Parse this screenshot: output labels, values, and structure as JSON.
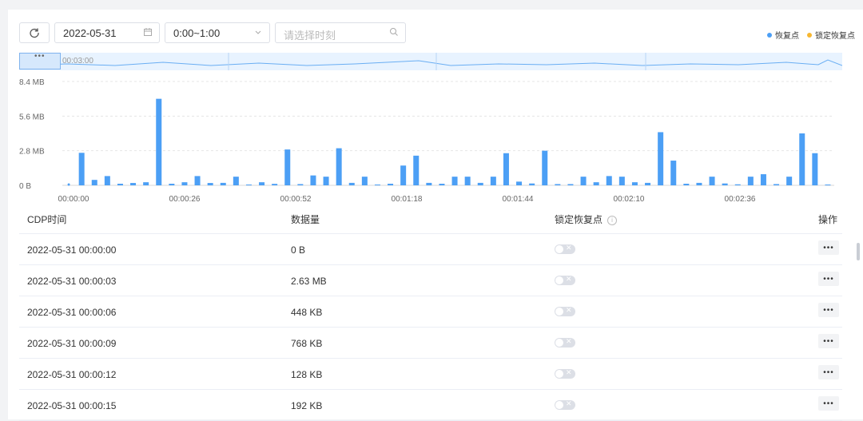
{
  "toolbar": {
    "date_value": "2022-05-31",
    "time_range_value": "0:00~1:00",
    "moment_placeholder": "请选择时刻"
  },
  "legend": [
    {
      "label": "恢复点",
      "color": "#4c9ff5"
    },
    {
      "label": "锁定恢复点",
      "color": "#f7b731"
    }
  ],
  "overview": {
    "label": "00:03:00"
  },
  "chart_data": {
    "type": "bar",
    "y_ticks": [
      "0 B",
      "2.8 MB",
      "5.6 MB",
      "8.4 MB"
    ],
    "ylim": [
      0,
      8.4
    ],
    "x_ticks": [
      "00:00:00",
      "00:00:26",
      "00:00:52",
      "00:01:18",
      "00:01:44",
      "00:02:10",
      "00:02:36"
    ],
    "bar_color": "#4c9ff5",
    "values": [
      0.0,
      2.63,
      0.44,
      0.75,
      0.13,
      0.19,
      0.25,
      7.0,
      0.13,
      0.25,
      0.75,
      0.19,
      0.2,
      0.7,
      0.06,
      0.25,
      0.12,
      2.9,
      0.1,
      0.8,
      0.7,
      3.0,
      0.2,
      0.7,
      0.06,
      0.13,
      1.6,
      2.4,
      0.2,
      0.13,
      0.7,
      0.7,
      0.2,
      0.7,
      2.6,
      0.3,
      0.15,
      2.8,
      0.1,
      0.1,
      0.7,
      0.25,
      0.75,
      0.7,
      0.25,
      0.2,
      4.3,
      2.0,
      0.13,
      0.2,
      0.7,
      0.15,
      0.08,
      0.7,
      0.9,
      0.1,
      0.7,
      4.2,
      2.6,
      0.05
    ]
  },
  "table": {
    "headers": [
      "CDP时间",
      "数据量",
      "锁定恢复点",
      "操作"
    ],
    "rows": [
      {
        "time": "2022-05-31 00:00:00",
        "size": "0 B"
      },
      {
        "time": "2022-05-31 00:00:03",
        "size": "2.63 MB"
      },
      {
        "time": "2022-05-31 00:00:06",
        "size": "448 KB"
      },
      {
        "time": "2022-05-31 00:00:09",
        "size": "768 KB"
      },
      {
        "time": "2022-05-31 00:00:12",
        "size": "128 KB"
      },
      {
        "time": "2022-05-31 00:00:15",
        "size": "192 KB"
      }
    ],
    "more_label": "•••"
  }
}
